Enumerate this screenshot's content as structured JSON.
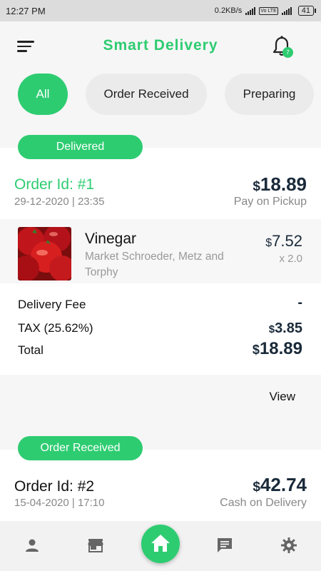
{
  "status_bar": {
    "time": "12:27 PM",
    "net_speed": "0.2KB/s",
    "volte": "Vo LTE",
    "battery": "41"
  },
  "header": {
    "title": "Smart Delivery",
    "notification_count": "7"
  },
  "filters": [
    {
      "label": "All",
      "active": true
    },
    {
      "label": "Order Received",
      "active": false
    },
    {
      "label": "Preparing",
      "active": false
    }
  ],
  "orders": [
    {
      "status": "Delivered",
      "id_label": "Order Id: #1",
      "datetime": "29-12-2020 | 23:35",
      "currency": "$",
      "total": "18.89",
      "payment": "Pay on Pickup",
      "items": [
        {
          "name": "Vinegar",
          "store": "Market Schroeder, Metz and Torphy",
          "currency": "$",
          "price": "7.52",
          "qty": "x 2.0"
        }
      ],
      "summary": {
        "delivery_fee_label": "Delivery Fee",
        "delivery_fee_value": "-",
        "tax_label": "TAX (25.62%)",
        "tax_currency": "$",
        "tax_value": "3.85",
        "total_label": "Total",
        "total_currency": "$",
        "total_value": "18.89"
      },
      "view_label": "View"
    },
    {
      "status": "Order Received",
      "id_label": "Order Id: #2",
      "datetime": "15-04-2020 | 17:10",
      "currency": "$",
      "total": "42.74",
      "payment": "Cash on Delivery"
    }
  ],
  "bottom_nav": [
    "profile-icon",
    "store-icon",
    "home-icon",
    "chat-icon",
    "settings-icon"
  ],
  "colors": {
    "accent": "#2ecc71",
    "price_text": "#1a2a3a"
  }
}
